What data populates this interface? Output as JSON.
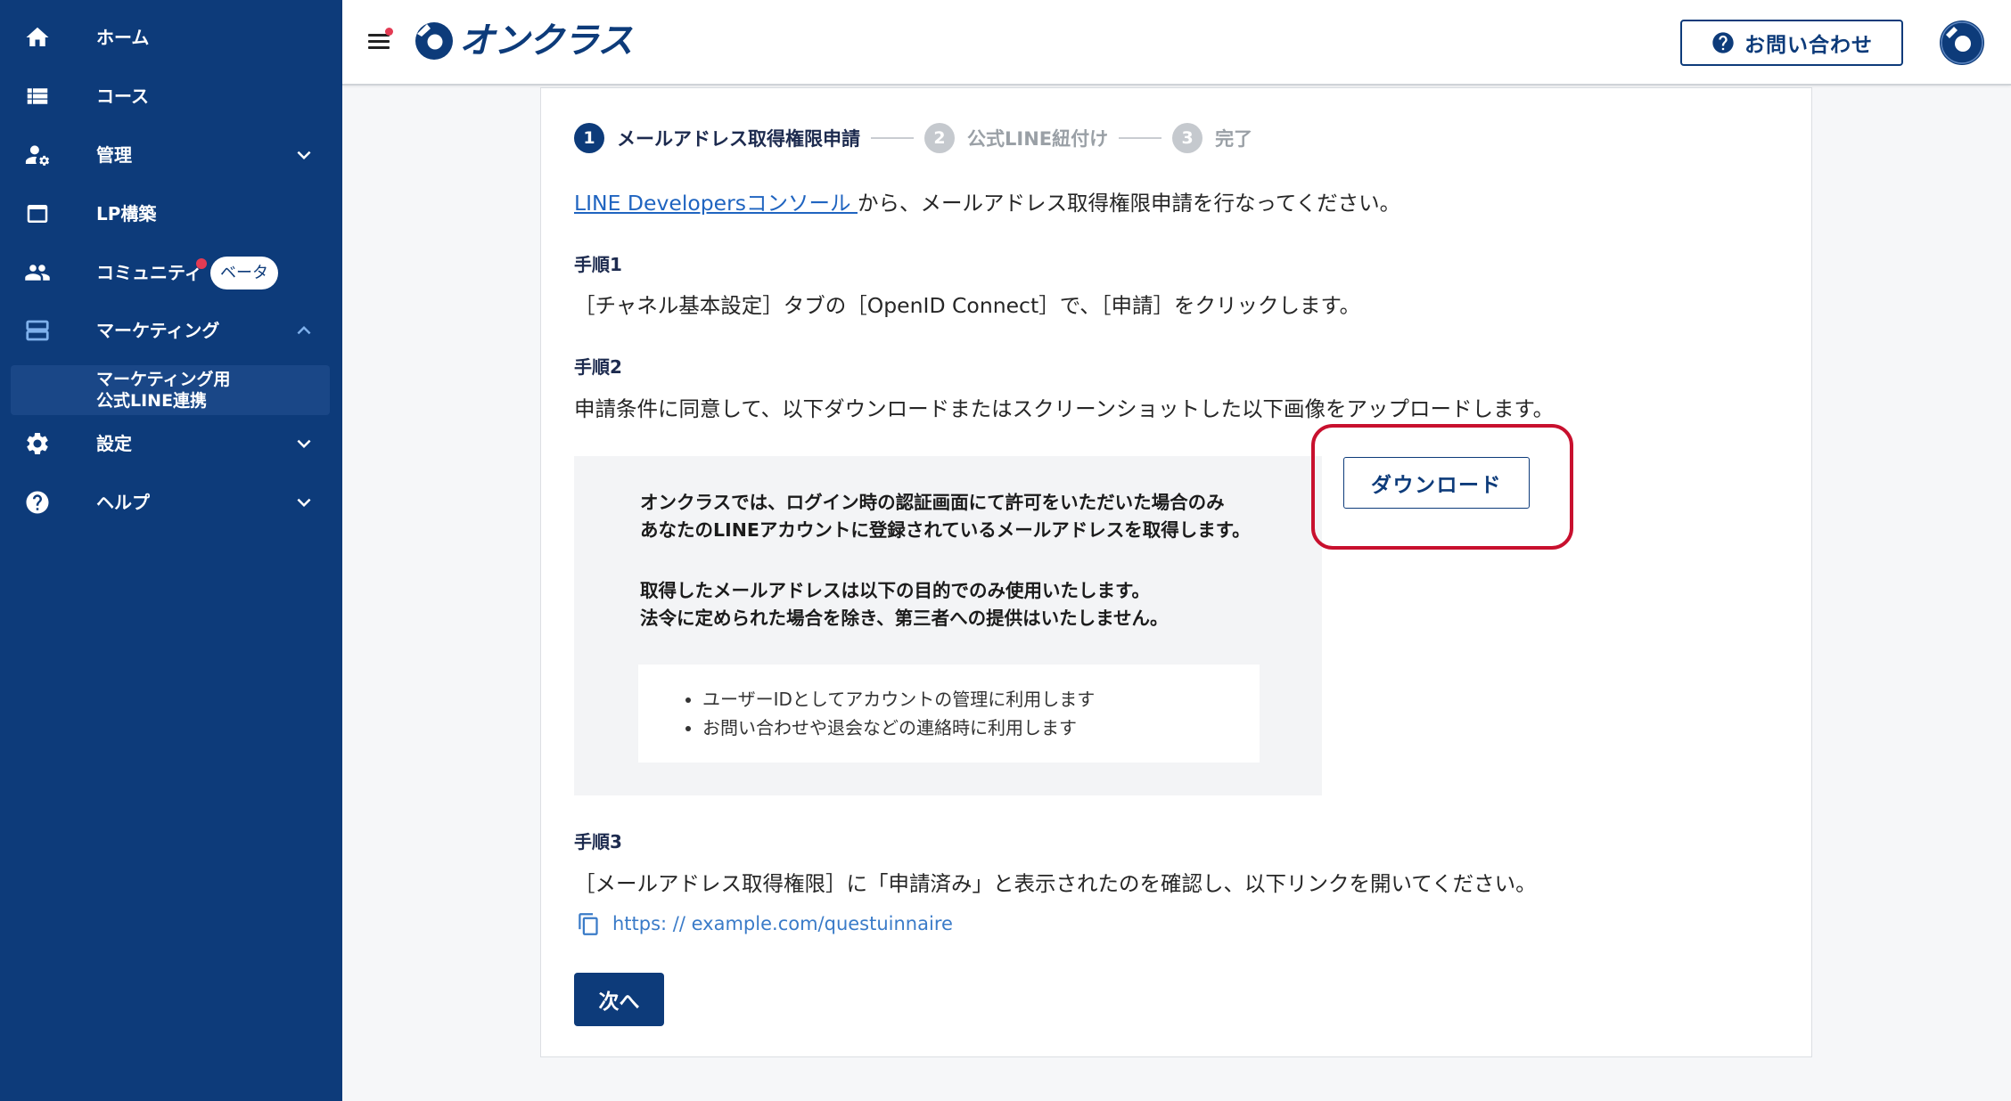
{
  "header": {
    "logo_text": "オンクラス",
    "contact_button": "お問い合わせ",
    "icons": {
      "menu": "menu-icon",
      "logo": "onclass-logo-icon",
      "contact": "help-circle-icon",
      "avatar": "avatar-icon"
    }
  },
  "sidebar": {
    "items": [
      {
        "label": "ホーム",
        "icon": "home-icon"
      },
      {
        "label": "コース",
        "icon": "list-icon"
      },
      {
        "label": "管理",
        "icon": "manage-accounts-icon",
        "chevron": "chevron-down-icon"
      },
      {
        "label": "LP構築",
        "icon": "window-icon"
      },
      {
        "label": "コミュニティ",
        "icon": "people-icon",
        "badge": "ベータ",
        "has_notification": true
      },
      {
        "label": "マーケティング",
        "icon": "layers-icon",
        "chevron": "chevron-up-icon",
        "expanded": true
      },
      {
        "label": "設定",
        "icon": "gear-icon",
        "chevron": "chevron-down-icon"
      },
      {
        "label": "ヘルプ",
        "icon": "help-icon",
        "chevron": "chevron-down-icon"
      }
    ],
    "active_sub_item": {
      "line1": "マーケティング用",
      "line2": "公式LINE連携"
    }
  },
  "stepper": {
    "steps": [
      {
        "number": "1",
        "label": "メールアドレス取得権限申請",
        "active": true
      },
      {
        "number": "2",
        "label": "公式LINE紐付け",
        "active": false
      },
      {
        "number": "3",
        "label": "完了",
        "active": false
      }
    ]
  },
  "content": {
    "intro": {
      "link_text": "LINE Developersコンソール ",
      "text": "から、メールアドレス取得権限申請を行なってください。"
    },
    "step1": {
      "title": "手順1",
      "text": "［チャネル基本設定］タブの［OpenID Connect］で、［申請］をクリックします。"
    },
    "step2": {
      "title": "手順2",
      "text": "申請条件に同意して、以下ダウンロードまたはスクリーンショットした以下画像をアップロードします。",
      "notice": {
        "paragraphs": [
          [
            "オンクラスでは、ログイン時の認証画面にて許可をいただいた場合のみ",
            "あなたのLINEアカウントに登録されているメールアドレスを取得します。"
          ],
          [
            "取得したメールアドレスは以下の目的でのみ使用いたします。",
            "法令に定められた場合を除き、第三者への提供はいたしません。"
          ]
        ],
        "bullets": [
          "ユーザーIDとしてアカウントの管理に利用します",
          "お問い合わせや退会などの連絡時に利用します"
        ]
      },
      "download_button": "ダウンロード"
    },
    "step3": {
      "title": "手順3",
      "text": "［メールアドレス取得権限］に「申請済み」と表示されたのを確認し、以下リンクを開いてください。",
      "link_text": "https: // example.com/questuinnaire",
      "copy_icon": "copy-icon"
    },
    "next_button": "次へ"
  },
  "colors": {
    "navy": "#0d3b7a",
    "navyLight": "#1a4787",
    "sidebarAccent": "#7fb1ec",
    "accentRed": "#e33b53",
    "annotationRed": "#c8102e",
    "link": "#1f64c0",
    "urlLink": "#3a7bc8",
    "muted": "#9aa0a6",
    "mutedCircle": "#c5c9ce",
    "heading": "#1d2b4f"
  }
}
